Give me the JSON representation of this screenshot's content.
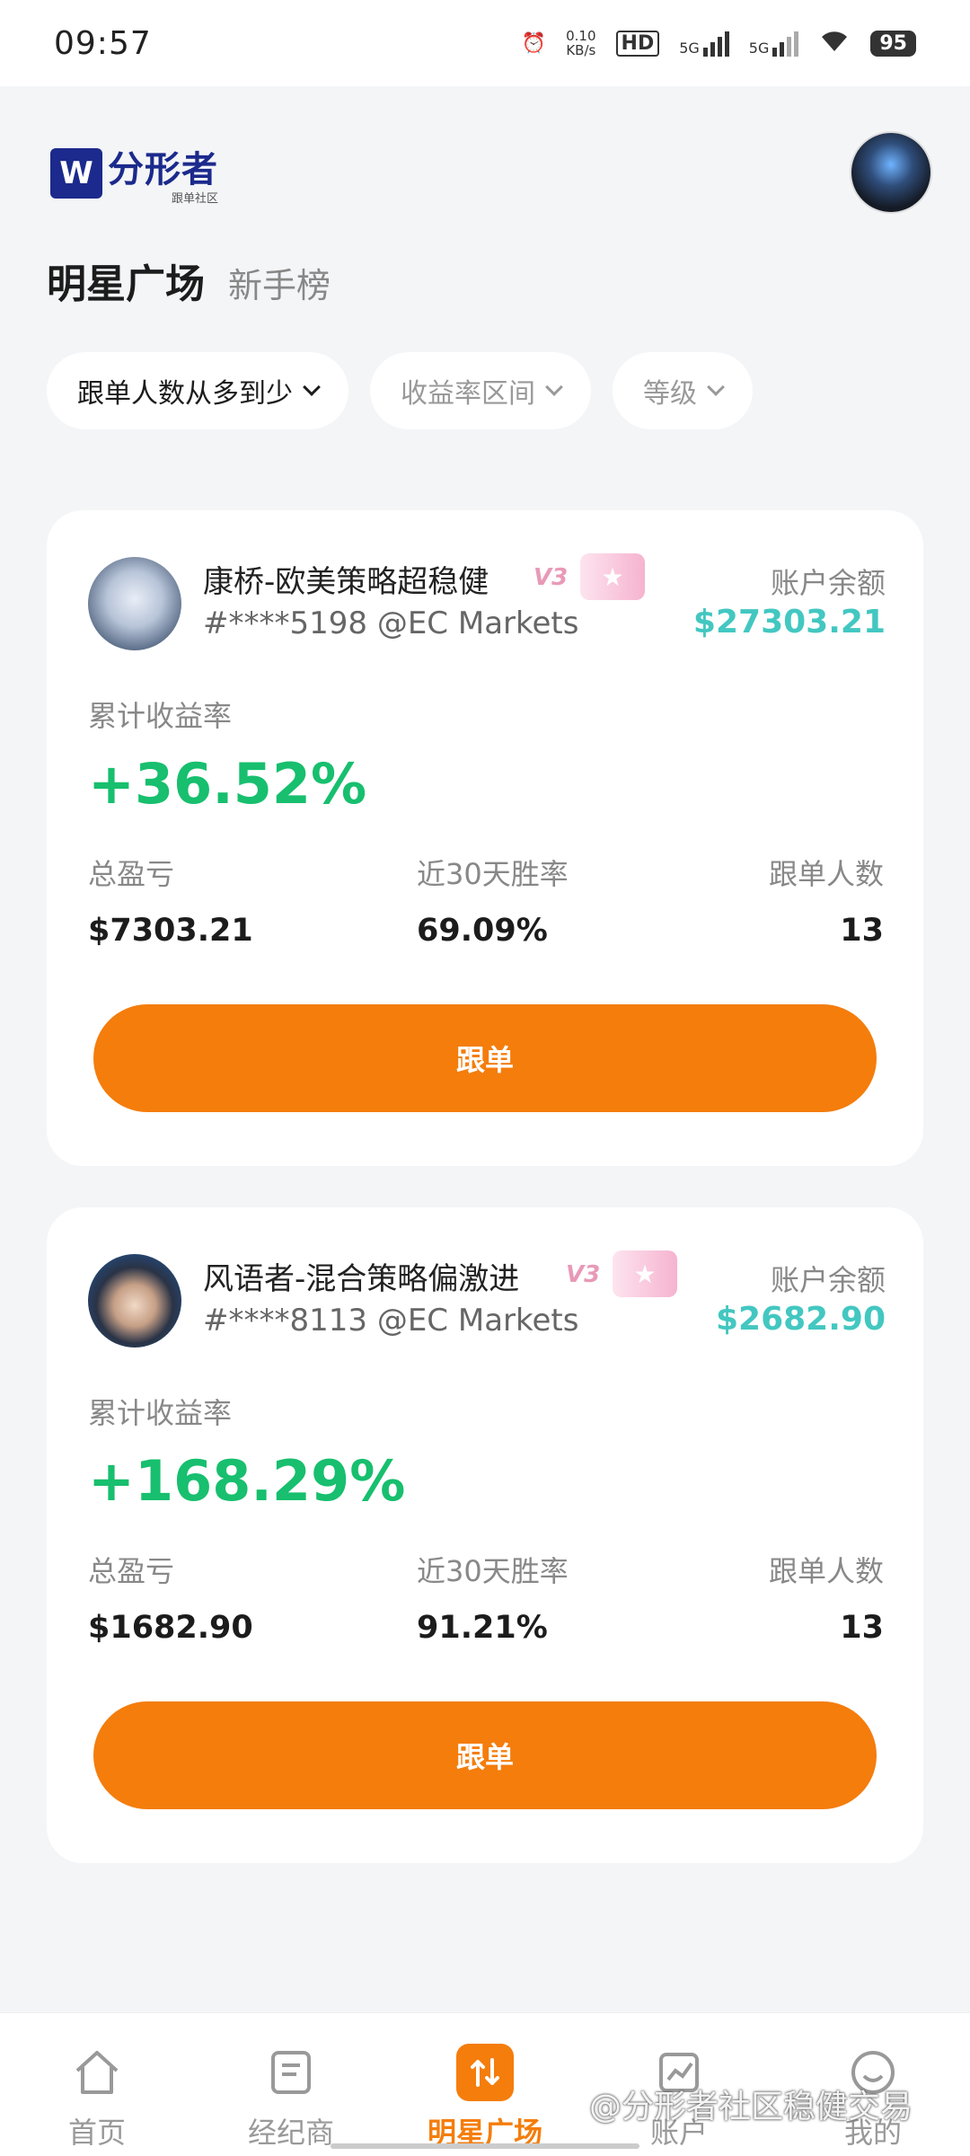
{
  "status_bar": {
    "time": "09:57",
    "net_speed_value": "0.10",
    "net_speed_unit": "KB/s",
    "hd_label": "HD",
    "signal1": "5G",
    "signal2": "5G",
    "battery": "95"
  },
  "header": {
    "logo_mark": "W",
    "logo_text": "分形者",
    "logo_sub": "跟单社区"
  },
  "tabs": {
    "active": "明星广场",
    "other": "新手榜"
  },
  "filters": [
    {
      "label": "跟单人数从多到少"
    },
    {
      "label": "收益率区间"
    },
    {
      "label": "等级"
    }
  ],
  "cards": [
    {
      "name": "康桥-欧美策略超稳健",
      "level": "V3",
      "id": "#****5198 @EC Markets",
      "balance_label": "账户余额",
      "balance": "$27303.21",
      "cum_label": "累计收益率",
      "cum_return": "+36.52%",
      "stat1_label": "总盈亏",
      "stat1_value": "$7303.21",
      "stat2_label": "近30天胜率",
      "stat2_value": "69.09%",
      "stat3_label": "跟单人数",
      "stat3_value": "13",
      "button": "跟单"
    },
    {
      "name": "风语者-混合策略偏激进",
      "level": "V3",
      "id": "#****8113 @EC Markets",
      "balance_label": "账户余额",
      "balance": "$2682.90",
      "cum_label": "累计收益率",
      "cum_return": "+168.29%",
      "stat1_label": "总盈亏",
      "stat1_value": "$1682.90",
      "stat2_label": "近30天胜率",
      "stat2_value": "91.21%",
      "stat3_label": "跟单人数",
      "stat3_value": "13",
      "button": "跟单"
    }
  ],
  "bottom_nav": [
    {
      "label": "首页",
      "icon": "home-icon"
    },
    {
      "label": "经纪商",
      "icon": "broker-icon"
    },
    {
      "label": "明星广场",
      "icon": "swap-icon"
    },
    {
      "label": "账户",
      "icon": "chart-icon"
    },
    {
      "label": "我的",
      "icon": "profile-icon"
    }
  ],
  "watermark": "@分形者社区稳健交易",
  "colors": {
    "accent": "#f47d0c",
    "positive": "#17bf6e",
    "balance": "#43c7c1"
  }
}
